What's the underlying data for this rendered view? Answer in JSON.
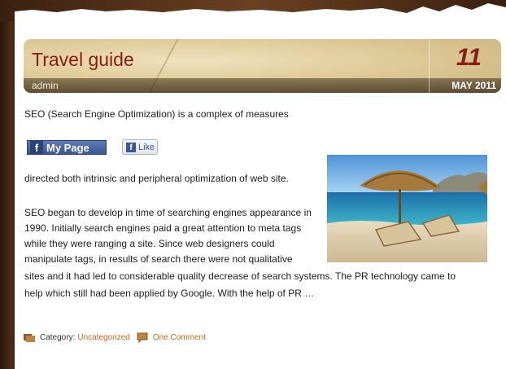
{
  "post": {
    "title": "Travel guide",
    "author": "admin",
    "date_day": "11",
    "date_month_year": "MAY 2011"
  },
  "content": {
    "line1": "SEO (Search Engine Optimization) is a complex of measures",
    "line2": "directed both intrinsic and peripheral optimization of web site.",
    "para2_lines": [
      "SEO began to develop in time of searching engines appearance in",
      "1990. Initially search engines paid a great attention to meta tags",
      "while they were ranging a site. Since web designers could",
      "manipulate tags, in results of search there were not qualitative",
      "sites and it had led to considerable quality decrease of search systems. The PR technology came to",
      "help which still had been applied by Google.  With the help of PR …"
    ]
  },
  "social": {
    "myspace_label": "My Page",
    "like_label": "Like"
  },
  "footer": {
    "category_label": "Category:",
    "category_value": "Uncategorized",
    "comments_link": "One Comment"
  },
  "icons": {
    "facebook": "facebook-icon",
    "folder": "category-icon",
    "comment": "comment-bubble-icon"
  },
  "colors": {
    "title": "#8a1c10",
    "link": "#d46a1a",
    "facebook_blue": "#3b5894"
  }
}
